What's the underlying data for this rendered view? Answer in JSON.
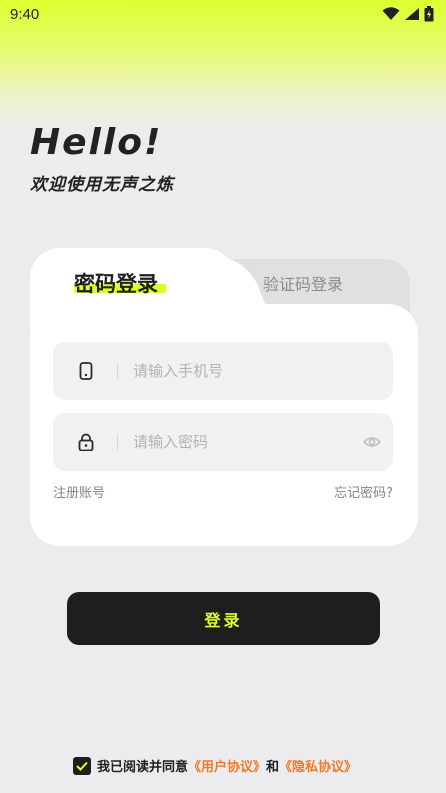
{
  "status_bar": {
    "time": "9:40",
    "icons": [
      "wifi-icon",
      "signal-icon",
      "battery-icon"
    ]
  },
  "hero": {
    "title": "Hello!",
    "subtitle": "欢迎使用无声之炼"
  },
  "tabs": [
    {
      "label": "密码登录",
      "active": true
    },
    {
      "label": "验证码登录",
      "active": false
    }
  ],
  "form": {
    "phone": {
      "value": "",
      "placeholder": "请输入手机号",
      "icon": "phone-icon"
    },
    "password": {
      "value": "",
      "placeholder": "请输入密码",
      "icon": "lock-icon",
      "toggle_icon": "eye-icon"
    },
    "register_link": "注册账号",
    "forgot_link": "忘记密码?"
  },
  "login_button": {
    "label": "登录"
  },
  "agreement": {
    "checked": true,
    "prefix": "我已阅读并同意",
    "user_agreement": "《用户协议》",
    "and": "和",
    "privacy_policy": "《隐私协议》"
  },
  "colors": {
    "accent": "#d9ff2f",
    "button": "#1e1e1e",
    "link": "#f07a26"
  }
}
